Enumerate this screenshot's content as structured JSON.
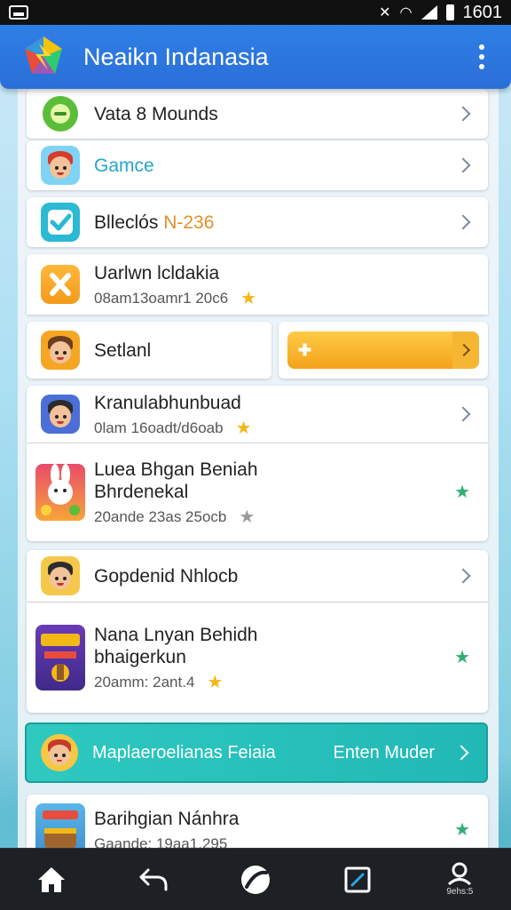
{
  "status_bar": {
    "time": "1601"
  },
  "app_bar": {
    "title": "Neaikn Indanasia"
  },
  "items": [
    {
      "title": "Vata 8 Mounds"
    },
    {
      "title": "Gamce"
    },
    {
      "title": "Blleclós",
      "tag": "N-236"
    },
    {
      "title": "Uarlwn lcldakia",
      "subtitle": "08am13oamr1 20c6"
    },
    {
      "title": "Setlanl"
    },
    {
      "title": "Kranulabhunbuad",
      "subtitle": "0lam 16oadt/d6oab"
    },
    {
      "title": "Luea Bhgan Beniah",
      "title2": "Bhrdenekal",
      "subtitle": "20ande 23as 25ocb"
    },
    {
      "title": "Gopdenid Nhlocb"
    },
    {
      "title": "Nana Lnyan Behidh",
      "title2": "bhaigerkun",
      "subtitle": "20amm: 2ant.4"
    },
    {
      "title": "Barihgian Nánhra",
      "subtitle": "Gaande: 19aa1.295"
    }
  ],
  "highlight": {
    "label": "Maplaeroelianas Feiaia",
    "action": "Enten Muder"
  },
  "nav": {
    "profile_label": "9ehs:5"
  },
  "colors": {
    "app_bar": "#2f7fe6",
    "accent_orange": "#f4a21c",
    "teal": "#2fc9c0",
    "star_gold": "#f2b817",
    "star_green": "#2fae74"
  }
}
